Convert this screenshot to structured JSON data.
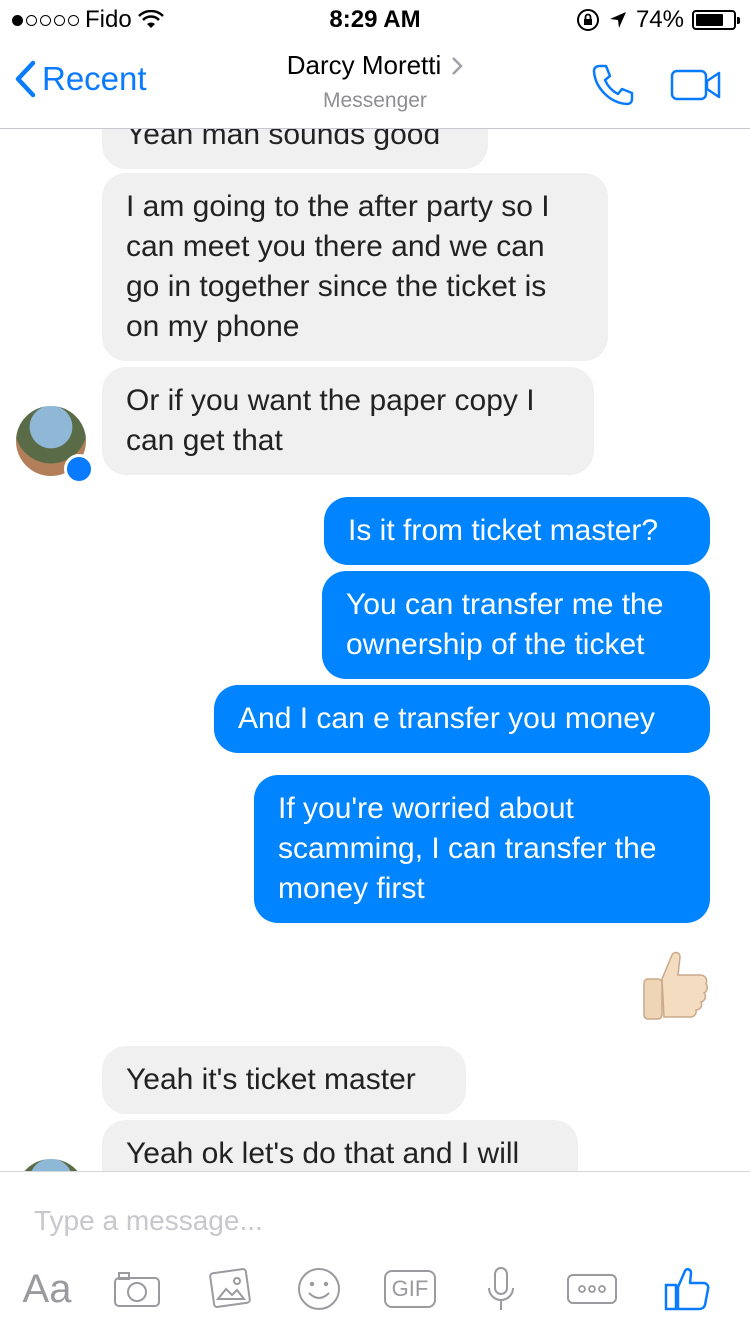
{
  "status": {
    "carrier": "Fido",
    "time": "8:29 AM",
    "battery_percent": "74%",
    "battery_level": 0.74,
    "signal_bars": 1,
    "signal_total": 5
  },
  "nav": {
    "back_label": "Recent",
    "contact_name": "Darcy Moretti",
    "subtitle": "Messenger",
    "accent": "#0a7bff"
  },
  "messages": [
    {
      "from": "them",
      "text": "Yeah man sounds good"
    },
    {
      "from": "them",
      "lines": [
        "I am going to the after party so I",
        "can meet you there and we can",
        "go in together since the ticket is",
        "on my phone"
      ]
    },
    {
      "from": "them",
      "lines": [
        "Or if you want the paper copy I",
        "can get that"
      ]
    },
    {
      "from": "me",
      "text": "Is it from ticket master?"
    },
    {
      "from": "me",
      "lines": [
        "You can transfer me the",
        "ownership of the ticket"
      ]
    },
    {
      "from": "me",
      "text": "And I can e transfer you money"
    },
    {
      "from": "me",
      "lines": [
        "If you're worried about",
        "scamming, I can transfer the",
        "money first"
      ]
    },
    {
      "from": "me",
      "emoji": "thumbs-up"
    },
    {
      "from": "them",
      "text": "Yeah it's ticket master"
    },
    {
      "from": "them",
      "text": "Yeah ok let's do that and I will"
    }
  ],
  "composer": {
    "placeholder": "Type a message...",
    "aa_label": "Aa",
    "gif_label": "GIF"
  },
  "colors": {
    "outgoing_bubble": "#0084ff",
    "incoming_bubble": "#f0f0f0"
  }
}
